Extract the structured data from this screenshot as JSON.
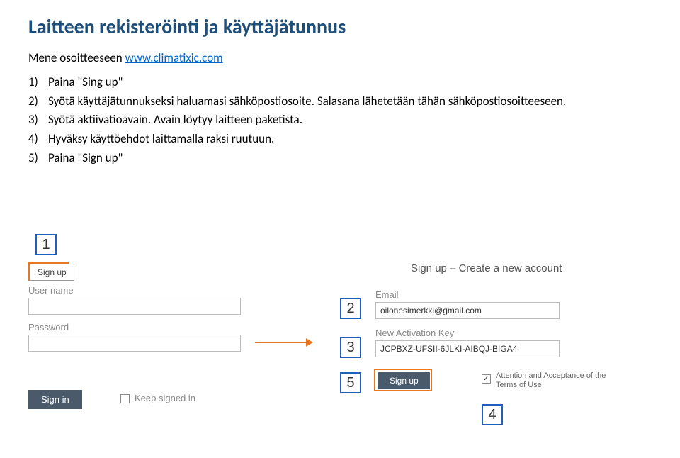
{
  "title": "Laitteen rekisteröinti ja käyttäjätunnus",
  "intro_prefix": "Mene osoitteeseen ",
  "intro_link": "www.climatixic.com",
  "steps": [
    {
      "num": "1)",
      "text": "Paina \"Sing up\""
    },
    {
      "num": "2)",
      "text": "Syötä käyttäjätunnukseksi haluamasi sähköpostiosoite. Salasana lähetetään tähän sähköpostiosoitteeseen."
    },
    {
      "num": "3)",
      "text": "Syötä aktiivatioavain. Avain löytyy laitteen paketista."
    },
    {
      "num": "4)",
      "text": "Hyväksy käyttöehdot laittamalla raksi ruutuun."
    },
    {
      "num": "5)",
      "text": "Paina \"Sign up\""
    }
  ],
  "form": {
    "signup_btn_top": "Sign up",
    "username_label": "User name",
    "password_label": "Password",
    "signin_btn": "Sign in",
    "keep_signed": "Keep signed in",
    "section_title": "Sign up – Create a new account",
    "email_label": "Email",
    "email_value": "oilonesimerkki@gmail.com",
    "act_label": "New Activation Key",
    "act_value": "JCPBXZ-UFSII-6JLKI-AIBQJ-BIGA4",
    "signup_btn_bottom": "Sign up",
    "terms": "Attention and Acceptance of the Terms of Use"
  },
  "callouts": {
    "c1": "1",
    "c2": "2",
    "c3": "3",
    "c4": "4",
    "c5": "5"
  }
}
